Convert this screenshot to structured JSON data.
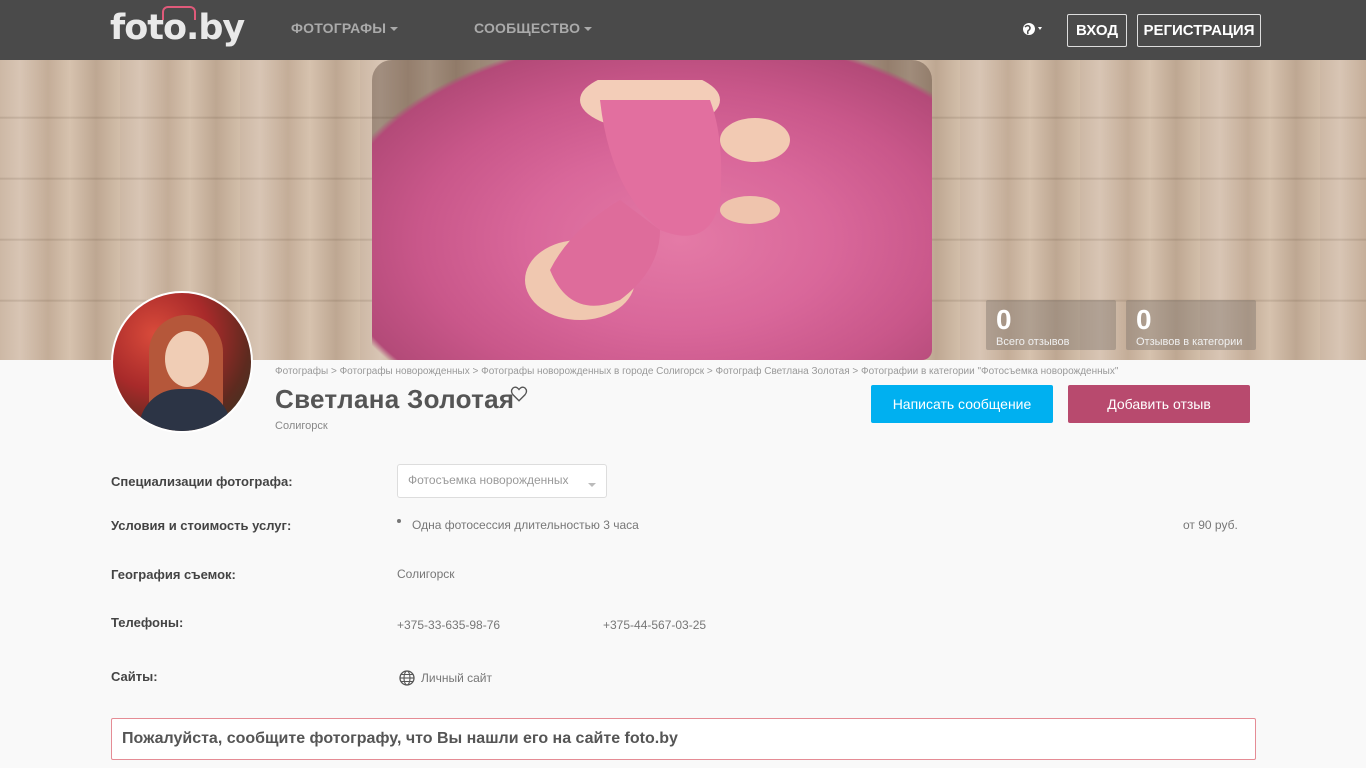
{
  "header": {
    "logo": "foto.by",
    "nav": [
      {
        "label": "ФОТОГРАФЫ"
      },
      {
        "label": "СООБЩЕСТВО"
      }
    ],
    "login_label": "ВХОД",
    "register_label": "РЕГИСТРАЦИЯ"
  },
  "stats": [
    {
      "value": "0",
      "label": "Всего отзывов"
    },
    {
      "value": "0",
      "label": "Отзывов в категории"
    }
  ],
  "breadcrumb": [
    "Фотографы",
    "Фотографы новорожденных",
    "Фотографы новорожденных в городе Солигорск",
    "Фотограф Светлана Золотая",
    "Фотографии в категории \"Фотосъемка новорожденных\""
  ],
  "breadcrumb_sep": ">",
  "profile": {
    "name": "Светлана Золотая",
    "city": "Солигорск",
    "message_button": "Написать сообщение",
    "review_button": "Добавить отзыв"
  },
  "details": {
    "specializations_label": "Специализации фотографа:",
    "specialization_selected": "Фотосъемка новорожденных",
    "services_label": "Условия и стоимость услуг:",
    "service_name": "Одна фотосессия длительностью 3 часа",
    "service_price": "от 90 руб.",
    "geography_label": "География съемок:",
    "geography_value": "Солигорск",
    "phones_label": "Телефоны:",
    "phones": [
      "+375-33-635-98-76",
      "+375-44-567-03-25"
    ],
    "sites_label": "Сайты:",
    "site_link": "Личный сайт"
  },
  "notice": "Пожалуйста, сообщите фотографу, что Вы нашли его на сайте foto.by",
  "colors": {
    "topbar": "#4a4a4a",
    "message_button": "#00b0f0",
    "review_button": "#b84a6e",
    "notice_border": "#e58c95"
  }
}
